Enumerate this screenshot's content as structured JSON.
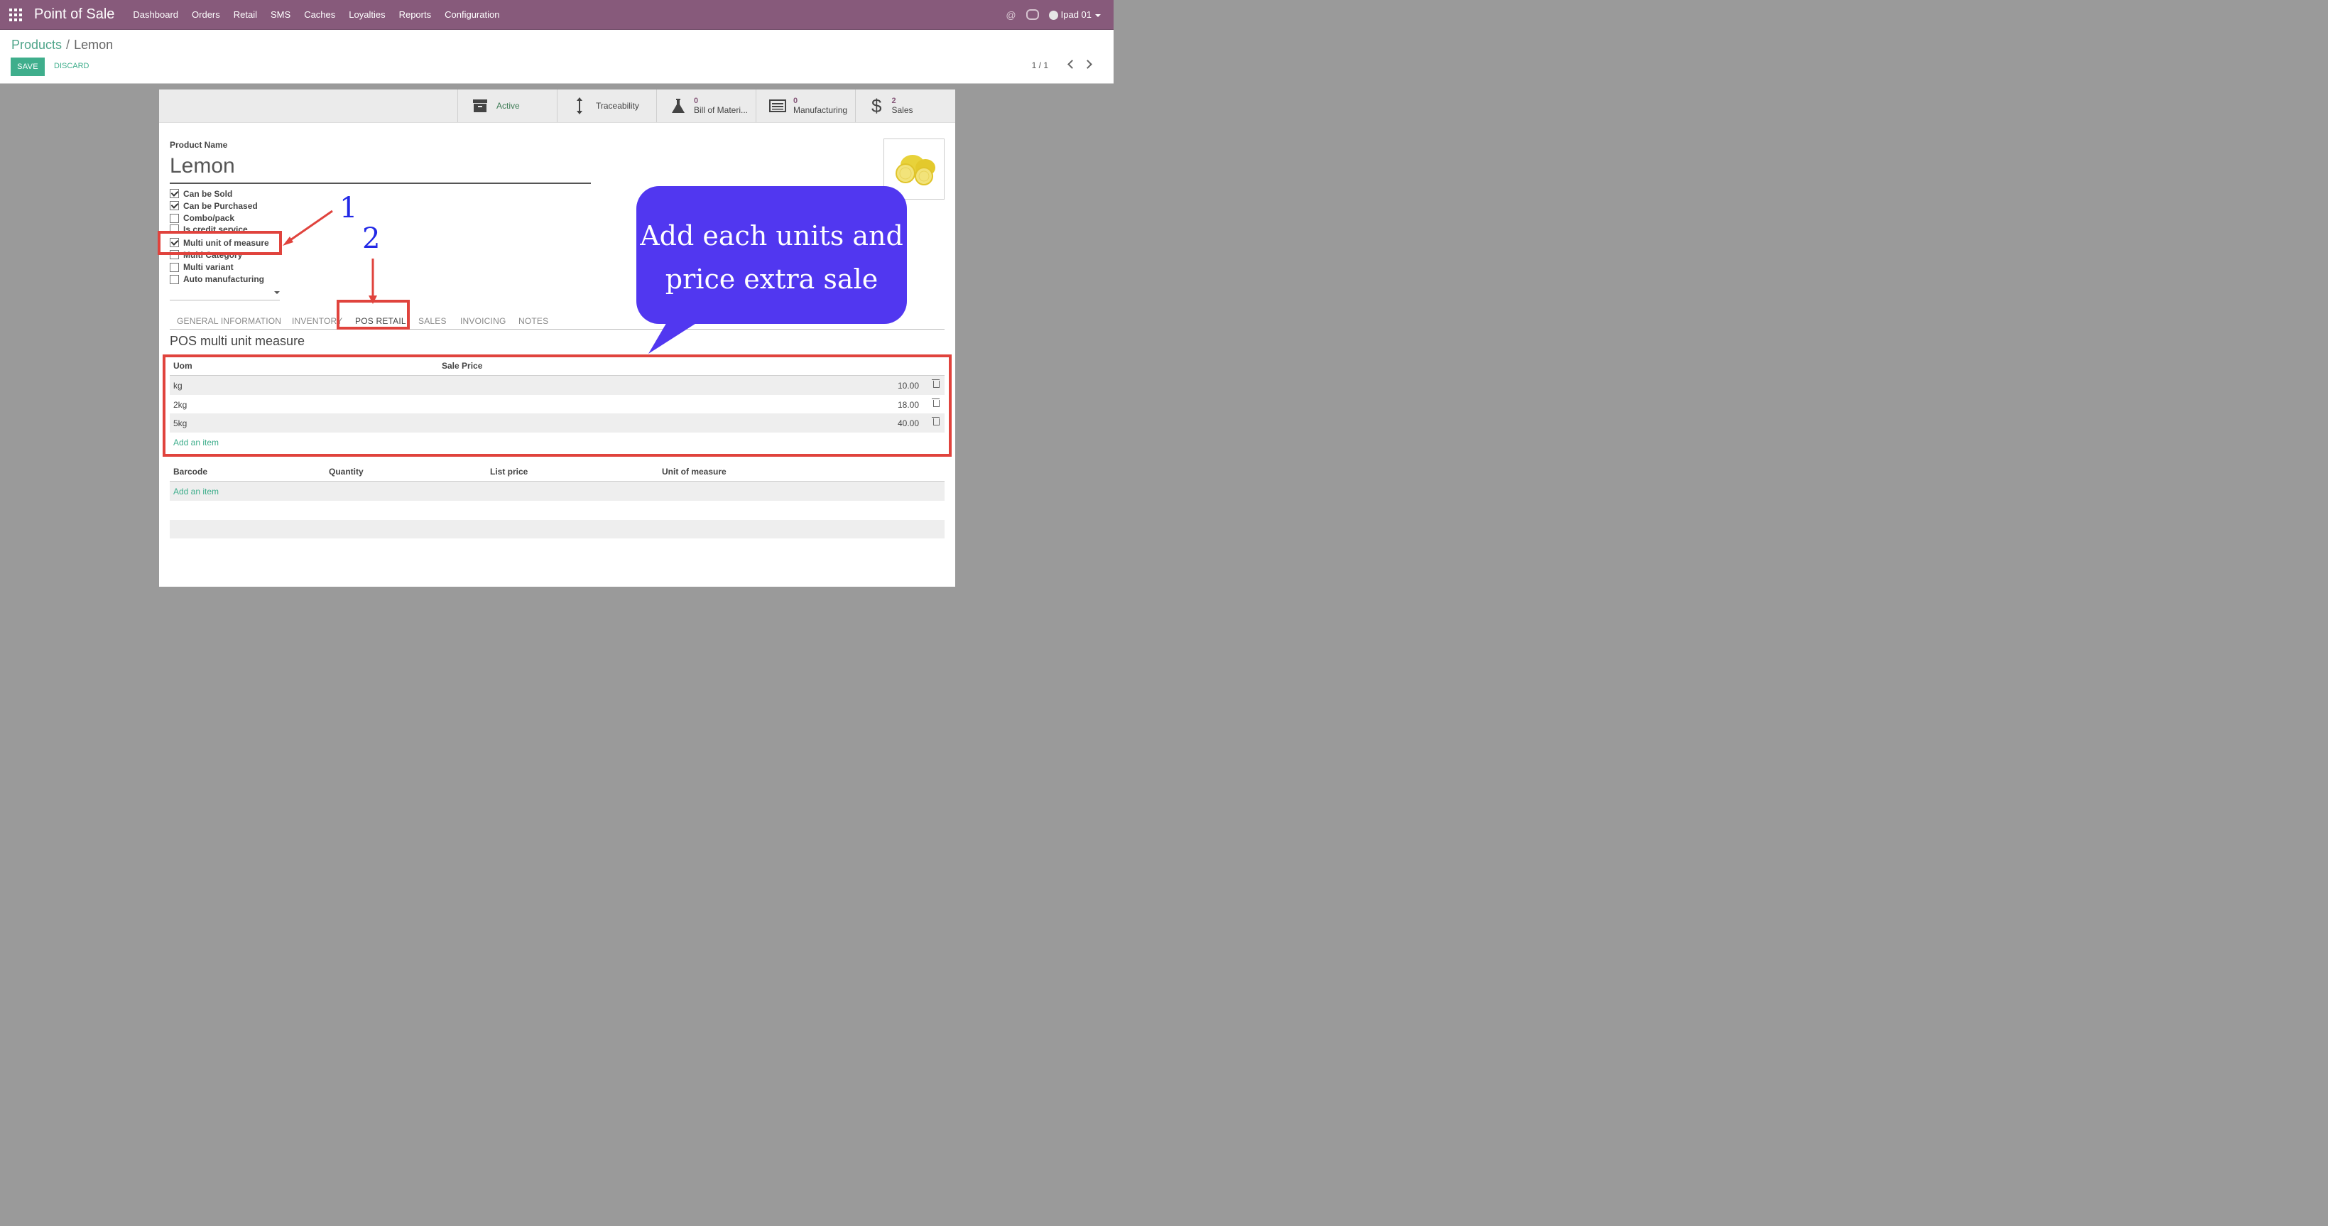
{
  "nav": {
    "app_title": "Point of Sale",
    "menu": [
      "Dashboard",
      "Orders",
      "Retail",
      "SMS",
      "Caches",
      "Loyalties",
      "Reports",
      "Configuration"
    ],
    "user": "Ipad 01",
    "icons": [
      "apps-grid-icon",
      "at-icon",
      "chat-icon",
      "avatar",
      "caret-down-icon"
    ]
  },
  "control": {
    "breadcrumb_parent": "Products",
    "breadcrumb_sep": "/",
    "breadcrumb_current": "Lemon",
    "save_label": "SAVE",
    "discard_label": "DISCARD",
    "pager": "1 / 1"
  },
  "stat_buttons": {
    "active": "Active",
    "traceability": "Traceability",
    "bom_count": "0",
    "bom_label": "Bill of Materi...",
    "mfg_count": "0",
    "mfg_label": "Manufacturing",
    "sales_count": "2",
    "sales_label": "Sales"
  },
  "form": {
    "name_label": "Product Name",
    "name": "Lemon",
    "checkboxes": [
      {
        "label": "Can be Sold",
        "checked": true
      },
      {
        "label": "Can be Purchased",
        "checked": true
      },
      {
        "label": "Combo/pack",
        "checked": false
      },
      {
        "label": "Is credit service",
        "checked": false
      },
      {
        "label": "Multi unit of measure",
        "checked": true
      },
      {
        "label": "Multi Category",
        "checked": false
      },
      {
        "label": "Multi variant",
        "checked": false
      },
      {
        "label": "Auto manufacturing",
        "checked": false
      }
    ]
  },
  "tabs": {
    "general": "GENERAL INFORMATION",
    "inventory": "INVENTORY",
    "pos_retail": "POS RETAIL",
    "sales": "SALES",
    "invoicing": "INVOICING",
    "notes": "NOTES",
    "active_tab": "POS RETAIL"
  },
  "uom_section": {
    "title": "POS multi unit measure",
    "col_uom": "Uom",
    "col_price": "Sale Price",
    "rows": [
      {
        "uom": "kg",
        "price": "10.00"
      },
      {
        "uom": "2kg",
        "price": "18.00"
      },
      {
        "uom": "5kg",
        "price": "40.00"
      }
    ],
    "add_item": "Add an item"
  },
  "barcode_section": {
    "col_barcode": "Barcode",
    "col_quantity": "Quantity",
    "col_list_price": "List price",
    "col_uom": "Unit of measure",
    "add_item": "Add an item"
  },
  "annotations": {
    "step1": "1",
    "step2": "2",
    "callout_line1": "Add each units and",
    "callout_line2": "price extra sale",
    "highlight_color": "#e0433d",
    "callout_color": "#5137f0"
  },
  "colors": {
    "nav_bg": "#875a7b",
    "primary": "#3fae8c",
    "link": "#4fa58a"
  }
}
